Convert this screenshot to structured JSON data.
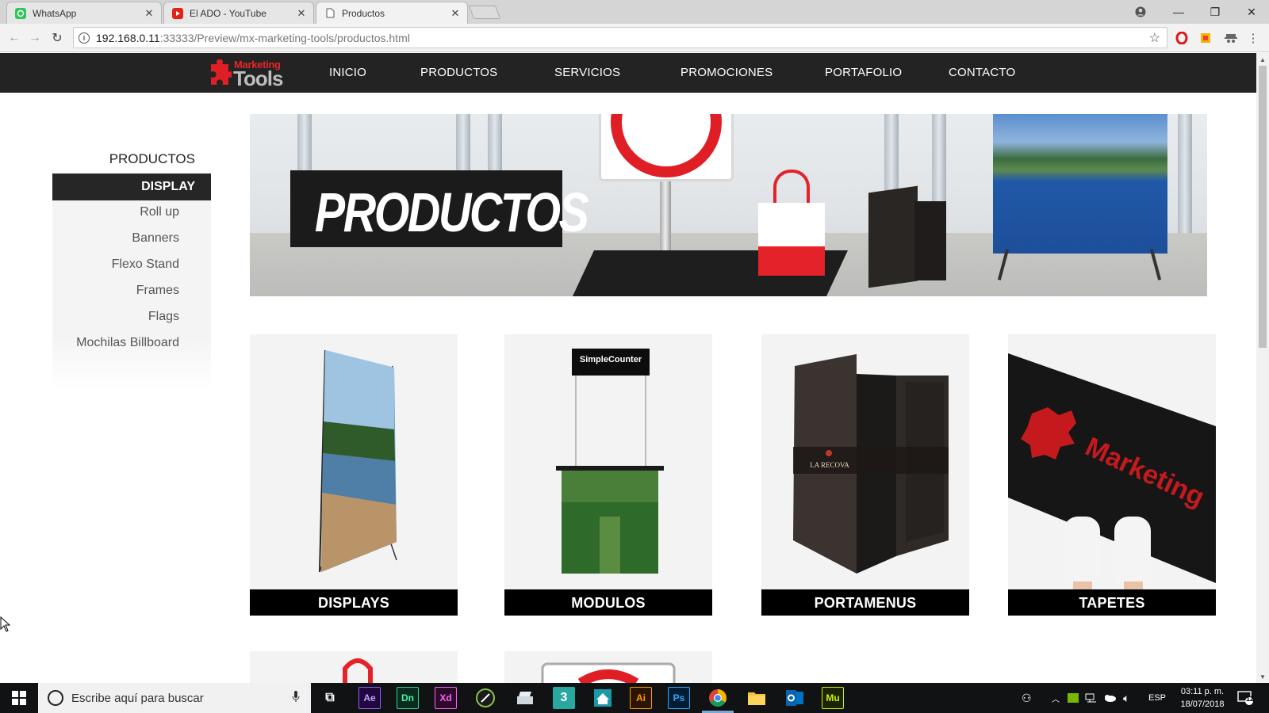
{
  "browser": {
    "tabs": [
      {
        "title": "WhatsApp",
        "icon": "whatsapp-icon",
        "active": false
      },
      {
        "title": "El ADO - YouTube",
        "icon": "youtube-icon",
        "active": false
      },
      {
        "title": "Productos",
        "icon": "document-icon",
        "active": true
      }
    ],
    "url_host": "192.168.0.11",
    "url_path": ":33333/Preview/mx-marketing-tools/productos.html"
  },
  "site": {
    "logo_top": "Marketing",
    "logo_bottom": "Tools",
    "nav": [
      "INICIO",
      "PRODUCTOS",
      "SERVICIOS",
      "PROMOCIONES",
      "PORTAFOLIO",
      "CONTACTO"
    ]
  },
  "sidebar": {
    "title": "PRODUCTOS",
    "active": "DISPLAY",
    "items": [
      "Roll up",
      "Banners",
      "Flexo Stand",
      "Frames",
      "Flags",
      "Mochilas Billboard"
    ]
  },
  "hero": {
    "title": "PRODUCTOS"
  },
  "products": [
    {
      "label": "DISPLAYS",
      "image": "x-banner-display"
    },
    {
      "label": "MODULOS",
      "image": "promo-counter-module",
      "module_sign": "SimpleCounter"
    },
    {
      "label": "PORTAMENUS",
      "image": "menu-holder",
      "menu_brand": "LA RECOVA"
    },
    {
      "label": "TAPETES",
      "image": "logo-mat"
    }
  ],
  "taskbar": {
    "search_placeholder": "Escribe aquí para buscar",
    "apps": [
      "Ae",
      "Dn",
      "Xd",
      "Ai",
      "Ps",
      "Mu"
    ],
    "language": "ESP",
    "time": "03:11 p. m.",
    "date": "18/07/2018",
    "notifications": "12"
  },
  "colors": {
    "nav_bg": "#232323",
    "accent_red": "#e01e25",
    "label_bg": "#000000"
  }
}
